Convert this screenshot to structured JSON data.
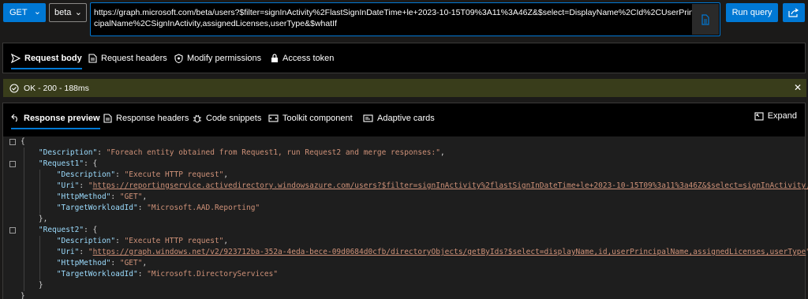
{
  "toolbar": {
    "method": "GET",
    "version": "beta",
    "url": "https://graph.microsoft.com/beta/users?$filter=signInActivity%2FlastSignInDateTime+le+2023-10-15T09%3A11%3A46Z&$select=DisplayName%2CId%2CUserPrincipalName%2CSignInActivity,assignedLicenses,userType&$whatIf",
    "run_query": "Run query"
  },
  "request_tabs": [
    {
      "label": "Request body",
      "icon": "send-icon"
    },
    {
      "label": "Request headers",
      "icon": "document-icon"
    },
    {
      "label": "Modify permissions",
      "icon": "shield-icon"
    },
    {
      "label": "Access token",
      "icon": "lock-icon"
    }
  ],
  "status": {
    "text": "OK - 200 - 188ms",
    "color": "#393d1b"
  },
  "response_tabs": [
    {
      "label": "Response preview",
      "icon": "undo-arrow-icon"
    },
    {
      "label": "Response headers",
      "icon": "document-icon"
    },
    {
      "label": "Code snippets",
      "icon": "bug-icon"
    },
    {
      "label": "Toolkit component",
      "icon": "toolkit-icon"
    },
    {
      "label": "Adaptive cards",
      "icon": "card-icon"
    }
  ],
  "expand_label": "Expand",
  "response_json": {
    "open_brace": "{",
    "description_key": "\"Description\"",
    "description_value": "\"Foreach entity obtained from Request1, run Request2 and merge responses:\"",
    "request1_key": "\"Request1\"",
    "request1": {
      "description_key": "\"Description\"",
      "description_value": "\"Execute HTTP request\"",
      "uri_key": "\"Uri\"",
      "uri_value": "https://reportingservice.activedirectory.windowsazure.com/users?$filter=signInActivity%2flastSignInDateTime+le+2023-10-15T09%3a11%3a46Z&$select=signInActivity,id",
      "method_key": "\"HttpMethod\"",
      "method_value": "\"GET\"",
      "workload_key": "\"TargetWorkloadId\"",
      "workload_value": "\"Microsoft.AAD.Reporting\""
    },
    "request2_key": "\"Request2\"",
    "request2": {
      "description_key": "\"Description\"",
      "description_value": "\"Execute HTTP request\"",
      "uri_key": "\"Uri\"",
      "uri_value": "https://graph.windows.net/v2/923712ba-352a-4eda-bece-09d0684d0cfb/directoryObjects/getByIds?$select=displayName,id,userPrincipalName,assignedLicenses,userType",
      "method_key": "\"HttpMethod\"",
      "method_value": "\"GET\"",
      "workload_key": "\"TargetWorkloadId\"",
      "workload_value": "\"Microsoft.DirectoryServices\""
    },
    "close_inner": "}",
    "close_inner_comma": "},",
    "close_brace": "}"
  },
  "colors": {
    "accent": "#0078d4",
    "json_key": "#9cdcfe",
    "json_string": "#ce9178",
    "status_bg": "#393d1b"
  }
}
